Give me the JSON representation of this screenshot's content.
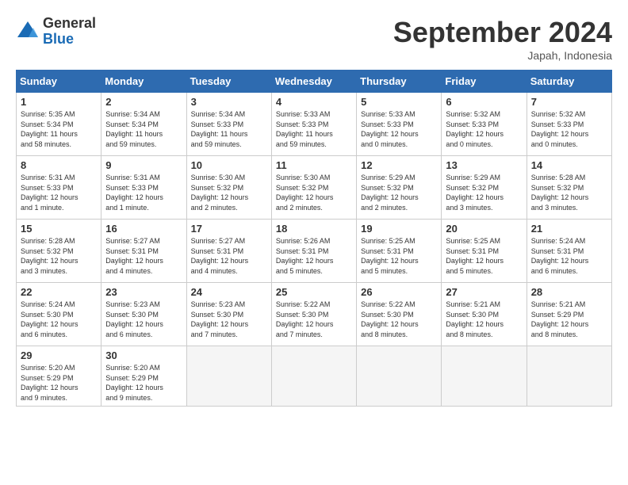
{
  "header": {
    "logo_general": "General",
    "logo_blue": "Blue",
    "month_title": "September 2024",
    "subtitle": "Japah, Indonesia"
  },
  "days_of_week": [
    "Sunday",
    "Monday",
    "Tuesday",
    "Wednesday",
    "Thursday",
    "Friday",
    "Saturday"
  ],
  "weeks": [
    [
      {
        "day": "1",
        "info": "Sunrise: 5:35 AM\nSunset: 5:34 PM\nDaylight: 11 hours\nand 58 minutes."
      },
      {
        "day": "2",
        "info": "Sunrise: 5:34 AM\nSunset: 5:34 PM\nDaylight: 11 hours\nand 59 minutes."
      },
      {
        "day": "3",
        "info": "Sunrise: 5:34 AM\nSunset: 5:33 PM\nDaylight: 11 hours\nand 59 minutes."
      },
      {
        "day": "4",
        "info": "Sunrise: 5:33 AM\nSunset: 5:33 PM\nDaylight: 11 hours\nand 59 minutes."
      },
      {
        "day": "5",
        "info": "Sunrise: 5:33 AM\nSunset: 5:33 PM\nDaylight: 12 hours\nand 0 minutes."
      },
      {
        "day": "6",
        "info": "Sunrise: 5:32 AM\nSunset: 5:33 PM\nDaylight: 12 hours\nand 0 minutes."
      },
      {
        "day": "7",
        "info": "Sunrise: 5:32 AM\nSunset: 5:33 PM\nDaylight: 12 hours\nand 0 minutes."
      }
    ],
    [
      {
        "day": "8",
        "info": "Sunrise: 5:31 AM\nSunset: 5:33 PM\nDaylight: 12 hours\nand 1 minute."
      },
      {
        "day": "9",
        "info": "Sunrise: 5:31 AM\nSunset: 5:33 PM\nDaylight: 12 hours\nand 1 minute."
      },
      {
        "day": "10",
        "info": "Sunrise: 5:30 AM\nSunset: 5:32 PM\nDaylight: 12 hours\nand 2 minutes."
      },
      {
        "day": "11",
        "info": "Sunrise: 5:30 AM\nSunset: 5:32 PM\nDaylight: 12 hours\nand 2 minutes."
      },
      {
        "day": "12",
        "info": "Sunrise: 5:29 AM\nSunset: 5:32 PM\nDaylight: 12 hours\nand 2 minutes."
      },
      {
        "day": "13",
        "info": "Sunrise: 5:29 AM\nSunset: 5:32 PM\nDaylight: 12 hours\nand 3 minutes."
      },
      {
        "day": "14",
        "info": "Sunrise: 5:28 AM\nSunset: 5:32 PM\nDaylight: 12 hours\nand 3 minutes."
      }
    ],
    [
      {
        "day": "15",
        "info": "Sunrise: 5:28 AM\nSunset: 5:32 PM\nDaylight: 12 hours\nand 3 minutes."
      },
      {
        "day": "16",
        "info": "Sunrise: 5:27 AM\nSunset: 5:31 PM\nDaylight: 12 hours\nand 4 minutes."
      },
      {
        "day": "17",
        "info": "Sunrise: 5:27 AM\nSunset: 5:31 PM\nDaylight: 12 hours\nand 4 minutes."
      },
      {
        "day": "18",
        "info": "Sunrise: 5:26 AM\nSunset: 5:31 PM\nDaylight: 12 hours\nand 5 minutes."
      },
      {
        "day": "19",
        "info": "Sunrise: 5:25 AM\nSunset: 5:31 PM\nDaylight: 12 hours\nand 5 minutes."
      },
      {
        "day": "20",
        "info": "Sunrise: 5:25 AM\nSunset: 5:31 PM\nDaylight: 12 hours\nand 5 minutes."
      },
      {
        "day": "21",
        "info": "Sunrise: 5:24 AM\nSunset: 5:31 PM\nDaylight: 12 hours\nand 6 minutes."
      }
    ],
    [
      {
        "day": "22",
        "info": "Sunrise: 5:24 AM\nSunset: 5:30 PM\nDaylight: 12 hours\nand 6 minutes."
      },
      {
        "day": "23",
        "info": "Sunrise: 5:23 AM\nSunset: 5:30 PM\nDaylight: 12 hours\nand 6 minutes."
      },
      {
        "day": "24",
        "info": "Sunrise: 5:23 AM\nSunset: 5:30 PM\nDaylight: 12 hours\nand 7 minutes."
      },
      {
        "day": "25",
        "info": "Sunrise: 5:22 AM\nSunset: 5:30 PM\nDaylight: 12 hours\nand 7 minutes."
      },
      {
        "day": "26",
        "info": "Sunrise: 5:22 AM\nSunset: 5:30 PM\nDaylight: 12 hours\nand 8 minutes."
      },
      {
        "day": "27",
        "info": "Sunrise: 5:21 AM\nSunset: 5:30 PM\nDaylight: 12 hours\nand 8 minutes."
      },
      {
        "day": "28",
        "info": "Sunrise: 5:21 AM\nSunset: 5:29 PM\nDaylight: 12 hours\nand 8 minutes."
      }
    ],
    [
      {
        "day": "29",
        "info": "Sunrise: 5:20 AM\nSunset: 5:29 PM\nDaylight: 12 hours\nand 9 minutes."
      },
      {
        "day": "30",
        "info": "Sunrise: 5:20 AM\nSunset: 5:29 PM\nDaylight: 12 hours\nand 9 minutes."
      },
      {
        "day": "",
        "info": ""
      },
      {
        "day": "",
        "info": ""
      },
      {
        "day": "",
        "info": ""
      },
      {
        "day": "",
        "info": ""
      },
      {
        "day": "",
        "info": ""
      }
    ]
  ]
}
